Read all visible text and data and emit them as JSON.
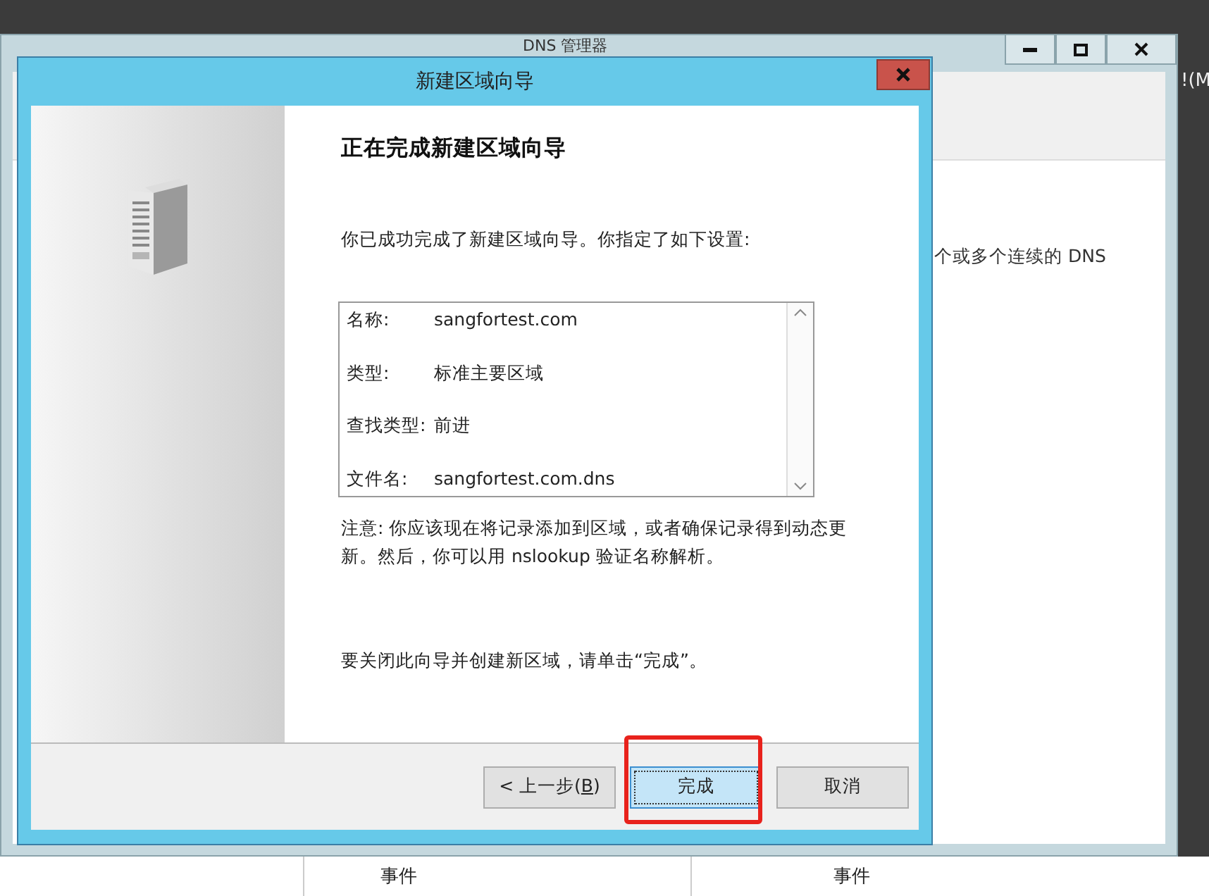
{
  "background_window": {
    "title": "DNS 管理器",
    "edge_text": "!(M",
    "pane_text": "个或多个连续的 DNS",
    "bottom_columns": [
      "事件",
      "事件"
    ]
  },
  "dialog": {
    "title": "新建区域向导",
    "heading": "正在完成新建区域向导",
    "intro": "你已成功完成了新建区域向导。你指定了如下设置:",
    "summary": [
      {
        "label": "名称:",
        "value": "sangfortest.com"
      },
      {
        "label": "类型:",
        "value": "标准主要区域"
      },
      {
        "label": "查找类型:",
        "value": "前进"
      },
      {
        "label": "文件名:",
        "value": "sangfortest.com.dns"
      }
    ],
    "note": "注意: 你应该现在将记录添加到区域，或者确保记录得到动态更新。然后，你可以用 nslookup 验证名称解析。",
    "closing": "要关闭此向导并创建新区域，请单击“完成”。",
    "buttons": [
      {
        "prefix": "< 上一步(",
        "accelerator": "B",
        "suffix": ")",
        "default": false,
        "highlighted": false
      },
      {
        "prefix": "完成",
        "default": true,
        "highlighted": true
      },
      {
        "prefix": "取消",
        "default": false,
        "highlighted": false
      }
    ]
  }
}
